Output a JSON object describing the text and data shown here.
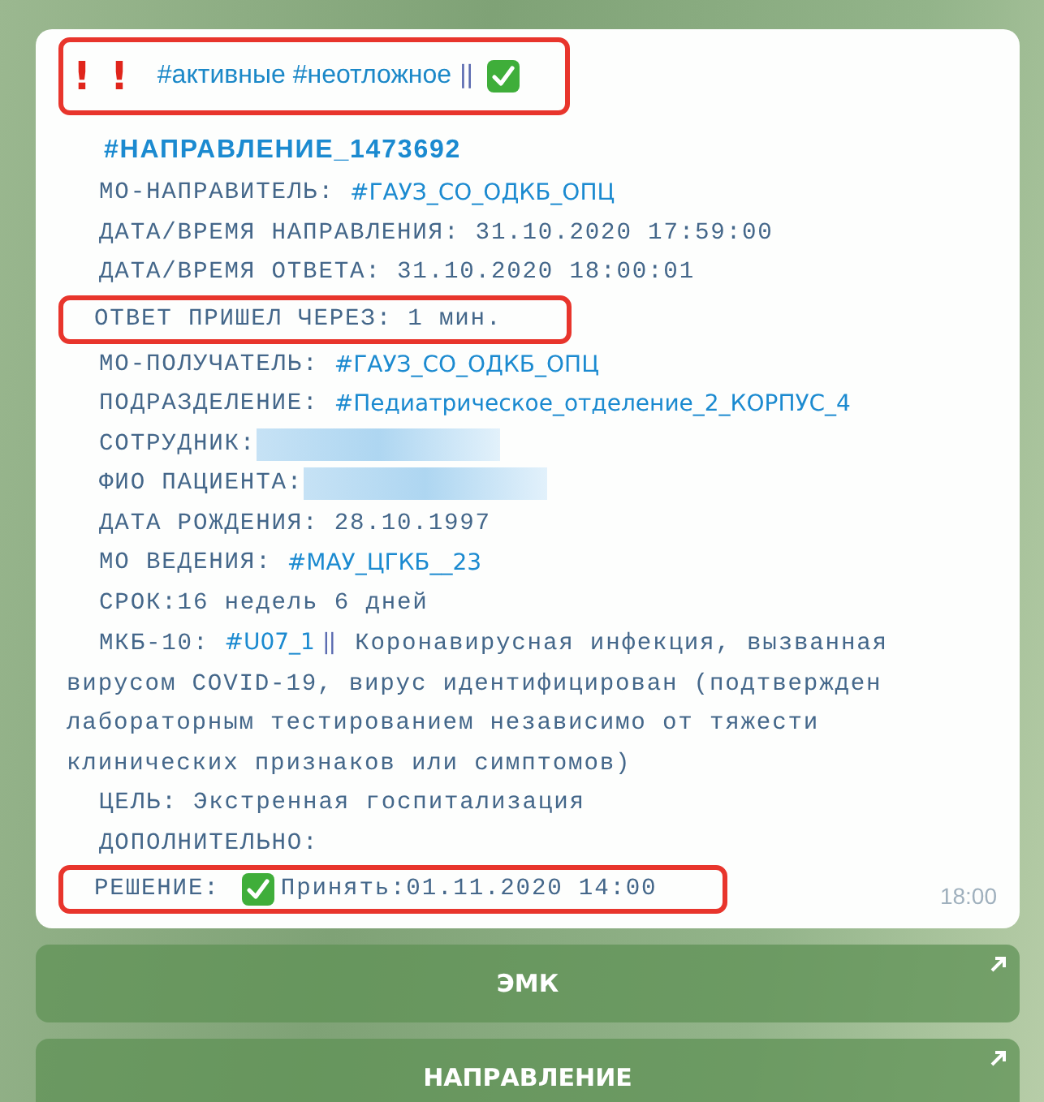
{
  "message": {
    "header": {
      "alerts": [
        "!",
        "!"
      ],
      "tags": "#активные #неотложное",
      "separator": "||",
      "checked": true,
      "highlighted": true
    },
    "title": "#НАПРАВЛЕНИЕ_1473692",
    "lines": [
      {
        "kind": "link",
        "label": "МО-НАПРАВИТЕЛЬ: ",
        "value": "#ГАУЗ_СО_ОДКБ_ОПЦ",
        "highlighted": false
      },
      {
        "kind": "plain",
        "label": "ДАТА/ВРЕМЯ НАПРАВЛЕНИЯ: ",
        "value": "31.10.2020 17:59:00",
        "highlighted": false
      },
      {
        "kind": "plain",
        "label": "ДАТА/ВРЕМЯ ОТВЕТА: ",
        "value": "31.10.2020 18:00:01",
        "highlighted": false
      },
      {
        "kind": "plain",
        "label": "ОТВЕТ ПРИШЕЛ ЧЕРЕЗ: ",
        "value": "1 мин.",
        "highlighted": true
      },
      {
        "kind": "link",
        "label": "МО-ПОЛУЧАТЕЛЬ: ",
        "value": "#ГАУЗ_СО_ОДКБ_ОПЦ",
        "highlighted": false
      },
      {
        "kind": "link",
        "label": "ПОДРАЗДЕЛЕНИЕ: ",
        "value": "#Педиатрическое_отделение_2_КОРПУС_4",
        "highlighted": false
      },
      {
        "kind": "redacted",
        "label": "СОТРУДНИК:",
        "highlighted": false
      },
      {
        "kind": "redacted",
        "label": "ФИО ПАЦИЕНТА:",
        "highlighted": false
      },
      {
        "kind": "plain",
        "label": "ДАТА РОЖДЕНИЯ: ",
        "value": "28.10.1997",
        "highlighted": false
      },
      {
        "kind": "link",
        "label": "МО ВЕДЕНИЯ: ",
        "value": "#МАУ_ЦГКБ__23",
        "highlighted": false
      },
      {
        "kind": "plain",
        "label": "СРОК:",
        "value": "16 недель 6 дней",
        "highlighted": false
      },
      {
        "kind": "diagnosis",
        "label": "МКБ-10: ",
        "code": "#U07_1",
        "separator": "||",
        "text": "Коронавирусная инфекция, вызванная вирусом COVID-19, вирус идентифицирован (подтвержден лабораторным тестированием независимо от тяжести клинических признаков или симптомов)",
        "highlighted": false
      },
      {
        "kind": "plain",
        "label": "ЦЕЛЬ: ",
        "value": "Экстренная госпитализация",
        "highlighted": false
      },
      {
        "kind": "plain",
        "label": "ДОПОЛНИТЕЛЬНО:",
        "highlighted": false
      },
      {
        "kind": "check",
        "label": "РЕШЕНИЕ: ",
        "checked": true,
        "value": "Принять:01.11.2020 14:00",
        "highlighted": true
      }
    ],
    "time": "18:00"
  },
  "buttons": [
    {
      "label": "ЭМК",
      "external": true
    },
    {
      "label": "НАПРАВЛЕНИЕ",
      "external": true
    }
  ]
}
